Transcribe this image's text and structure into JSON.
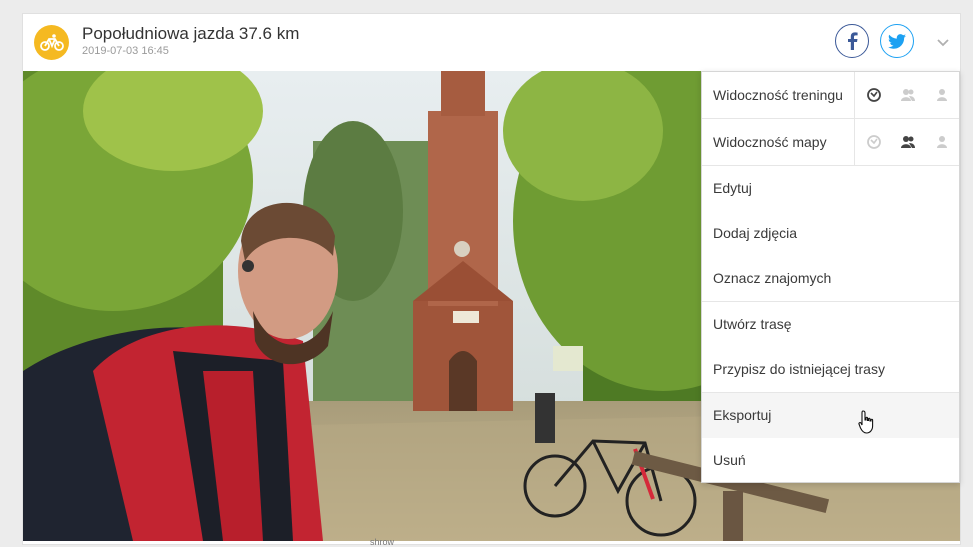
{
  "activity": {
    "title": "Popołudniowa jazda 37.6 km",
    "date": "2019-07-03 16:45",
    "sport_icon": "cycling-icon",
    "accent": "#f5b921"
  },
  "share": {
    "facebook_icon": "facebook-icon",
    "twitter_icon": "twitter-icon",
    "expand_icon": "chevron-down-icon"
  },
  "photo": {
    "alt": "selfie-photo"
  },
  "caption_partial": "shrow",
  "menu": {
    "visibility": [
      {
        "label": "Widoczność treningu",
        "selected": "public"
      },
      {
        "label": "Widoczność mapy",
        "selected": "friends"
      }
    ],
    "items": [
      {
        "label": "Edytuj"
      },
      {
        "label": "Dodaj zdjęcia"
      },
      {
        "label": "Oznacz znajomych"
      },
      {
        "label": "Utwórz trasę"
      },
      {
        "label": "Przypisz do istniejącej trasy"
      },
      {
        "label": "Eksportuj"
      },
      {
        "label": "Usuń"
      }
    ]
  }
}
